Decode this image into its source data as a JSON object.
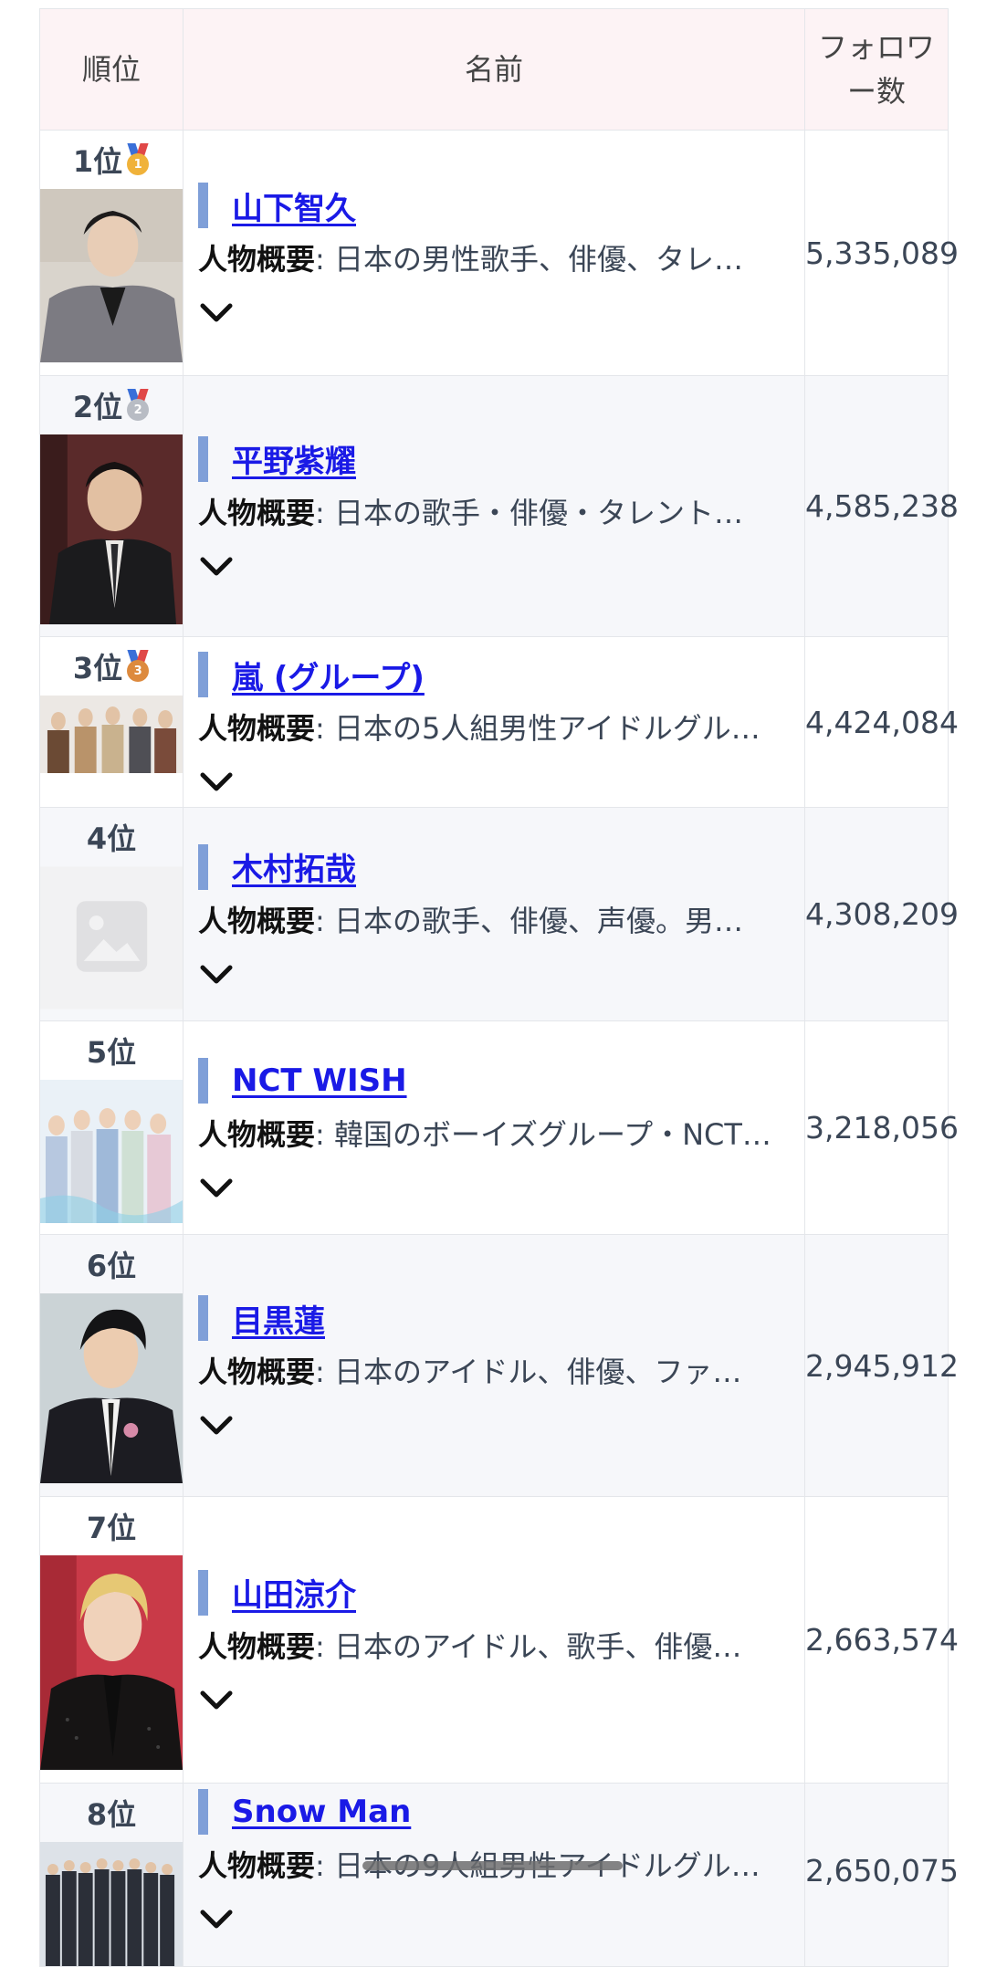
{
  "table": {
    "headers": {
      "rank": "順位",
      "name": "名前",
      "followers": "フォロワー数"
    },
    "summary_label": "人物概要",
    "rows": [
      {
        "rank": "1位",
        "medal": "gold",
        "name": "山下智久",
        "summary": "日本の男性歌手、俳優、タレ…",
        "followers": "5,335,089",
        "photo": "man-grey-suit-portrait"
      },
      {
        "rank": "2位",
        "medal": "silver",
        "name": "平野紫耀",
        "summary": "日本の歌手・俳優・タレント…",
        "followers": "4,585,238",
        "photo": "man-black-suit-portrait"
      },
      {
        "rank": "3位",
        "medal": "bronze",
        "name": "嵐 (グループ)",
        "summary": "日本の5人組男性アイドルグル…",
        "followers": "4,424,084",
        "photo": "five-man-group-photo"
      },
      {
        "rank": "4位",
        "medal": "",
        "name": "木村拓哉",
        "summary": "日本の歌手、俳優、声優。男…",
        "followers": "4,308,209",
        "photo": "image-placeholder-icon"
      },
      {
        "rank": "5位",
        "medal": "",
        "name": "NCT WISH",
        "summary": "韓国のボーイズグループ・NCT…",
        "followers": "3,218,056",
        "photo": "boy-group-photo"
      },
      {
        "rank": "6位",
        "medal": "",
        "name": "目黒蓮",
        "summary": "日本のアイドル、俳優、ファ…",
        "followers": "2,945,912",
        "photo": "man-black-jacket-portrait"
      },
      {
        "rank": "7位",
        "medal": "",
        "name": "山田涼介",
        "summary": "日本のアイドル、歌手、俳優…",
        "followers": "2,663,574",
        "photo": "blond-man-portrait"
      },
      {
        "rank": "8位",
        "medal": "",
        "name": "Snow Man",
        "summary": "日本の9人組男性アイドルグル…",
        "followers": "2,650,075",
        "photo": "nine-man-group-photo"
      }
    ]
  },
  "icons": {
    "expand": "chevron-down-icon",
    "medals": {
      "gold": "1",
      "silver": "2",
      "bronze": "3"
    }
  }
}
